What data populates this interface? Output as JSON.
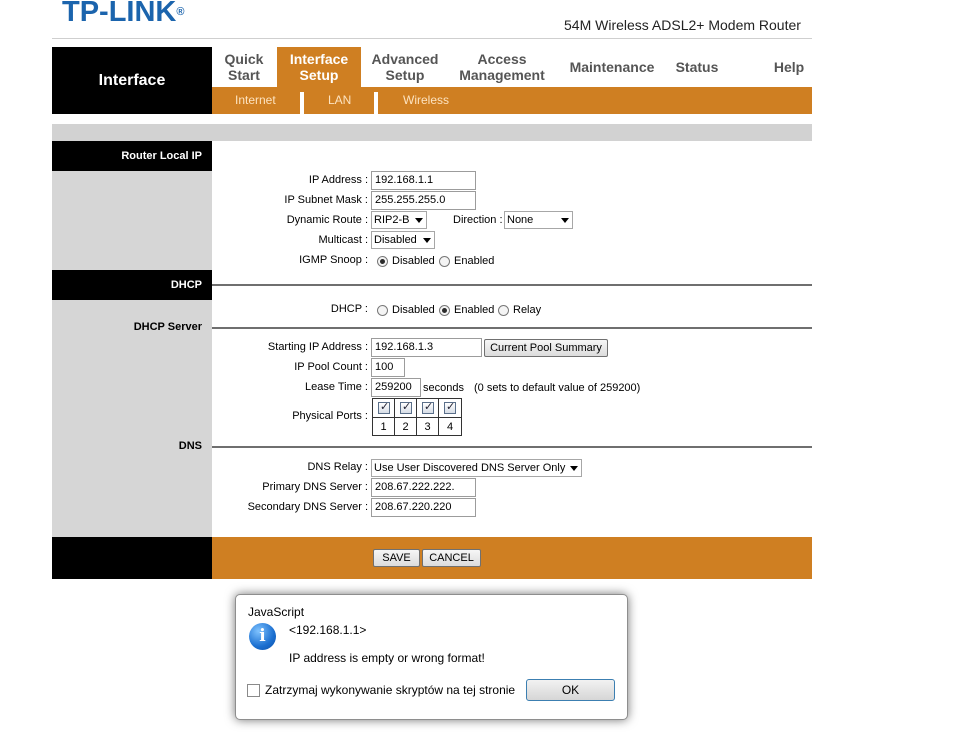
{
  "header": {
    "logo": "TP-LINK",
    "logo_mark": "®",
    "product": "54M Wireless ADSL2+ Modem Router"
  },
  "nav": {
    "section_title": "Interface",
    "items": [
      {
        "line1": "Quick",
        "line2": "Start"
      },
      {
        "line1": "Interface",
        "line2": "Setup",
        "active": true
      },
      {
        "line1": "Advanced",
        "line2": "Setup"
      },
      {
        "line1": "Access",
        "line2": "Management"
      },
      {
        "line1": "Maintenance",
        "line2": ""
      },
      {
        "line1": "Status",
        "line2": ""
      },
      {
        "line1": "Help",
        "line2": ""
      }
    ],
    "subtabs": [
      "Internet",
      "LAN",
      "Wireless"
    ]
  },
  "router_local_ip": {
    "section": "Router Local IP",
    "ip_label": "IP Address :",
    "ip_value": "192.168.1.1",
    "mask_label": "IP Subnet Mask :",
    "mask_value": "255.255.255.0",
    "dynroute_label": "Dynamic Route :",
    "dynroute_value": "RIP2-B",
    "direction_label": "Direction :",
    "direction_value": "None",
    "multicast_label": "Multicast :",
    "multicast_value": "Disabled",
    "igmp_label": "IGMP Snoop :",
    "igmp_opt1": "Disabled",
    "igmp_opt2": "Enabled"
  },
  "dhcp": {
    "section": "DHCP",
    "dhcp_label": "DHCP :",
    "opt_disabled": "Disabled",
    "opt_enabled": "Enabled",
    "opt_relay": "Relay",
    "server_section": "DHCP Server",
    "start_label": "Starting IP Address :",
    "start_value": "192.168.1.3",
    "pool_button": "Current Pool Summary",
    "count_label": "IP Pool Count :",
    "count_value": "100",
    "lease_label": "Lease Time :",
    "lease_value": "259200",
    "lease_unit": "seconds",
    "lease_note": "(0 sets to default value of 259200)",
    "ports_label": "Physical Ports :",
    "ports": [
      "1",
      "2",
      "3",
      "4"
    ]
  },
  "dns": {
    "section": "DNS",
    "relay_label": "DNS Relay :",
    "relay_value": "Use User Discovered DNS Server Only",
    "primary_label": "Primary DNS Server :",
    "primary_value": "208.67.222.222.",
    "secondary_label": "Secondary DNS Server :",
    "secondary_value": "208.67.220.220"
  },
  "footer": {
    "save": "SAVE",
    "cancel": "CANCEL"
  },
  "dialog": {
    "title": "JavaScript",
    "icon": "info-icon",
    "line1": "<192.168.1.1>",
    "line2": "IP address is empty or wrong format!",
    "checkbox_label": "Zatrzymaj wykonywanie skryptów na tej stronie",
    "ok": "OK"
  },
  "colors": {
    "accent_orange": "#cf7f22",
    "logo_blue": "#1b64ad"
  }
}
